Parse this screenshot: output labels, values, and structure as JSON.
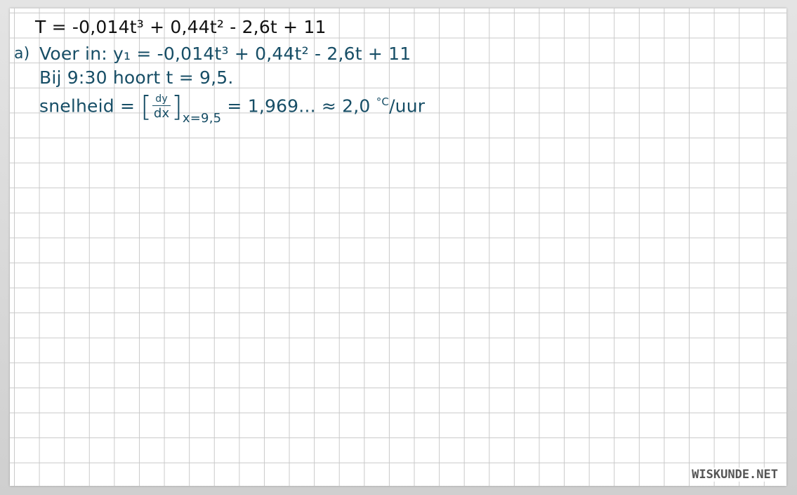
{
  "lines": {
    "formula": "T = -0,014t³ + 0,44t² - 2,6t + 11",
    "part_label": "a)",
    "step1": "Voer in: y₁ = -0,014t³ + 0,44t² - 2,6t + 11",
    "step2": "Bij 9:30 hoort t = 9,5.",
    "step3_prefix": "snelheid = ",
    "deriv_num": "dy",
    "deriv_den": "dx",
    "deriv_sub": "x=9,5",
    "step3_result": " = 1,969... ≈ 2,0 ",
    "unit_sup": "°C",
    "unit": "/uur"
  },
  "watermark": "WISKUNDE.NET",
  "colors": {
    "ink_black": "#111111",
    "ink_blue": "#174e66",
    "grid": "#c9c9c9"
  }
}
